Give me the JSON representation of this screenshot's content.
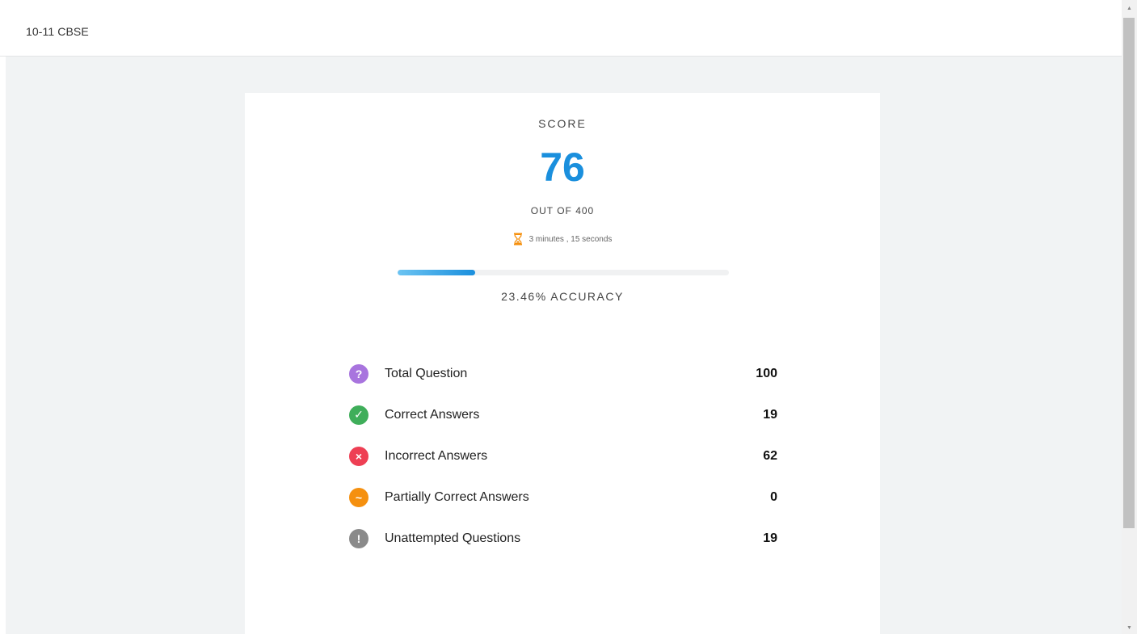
{
  "header": {
    "title": "10-11 CBSE"
  },
  "result": {
    "score_label": "SCORE",
    "score": "76",
    "out_of": "OUT OF 400",
    "time_taken": "3 minutes , 15 seconds",
    "accuracy_text": "23.46% ACCURACY",
    "accuracy_fraction": 0.2346
  },
  "stats": [
    {
      "label": "Total Question",
      "value": "100",
      "icon": "question-icon",
      "color": "#a874de",
      "glyph": "?"
    },
    {
      "label": "Correct Answers",
      "value": "19",
      "icon": "check-icon",
      "color": "#3fae5a",
      "glyph": "✓"
    },
    {
      "label": "Incorrect Answers",
      "value": "62",
      "icon": "cross-icon",
      "color": "#ee3f54",
      "glyph": "×"
    },
    {
      "label": "Partially Correct Answers",
      "value": "0",
      "icon": "partial-icon",
      "color": "#f5900f",
      "glyph": "~"
    },
    {
      "label": "Unattempted Questions",
      "value": "19",
      "icon": "exclamation-icon",
      "color": "#8a8a8a",
      "glyph": "!"
    }
  ],
  "colors": {
    "accent": "#1a8fdd",
    "hourglass": "#f5900f"
  }
}
